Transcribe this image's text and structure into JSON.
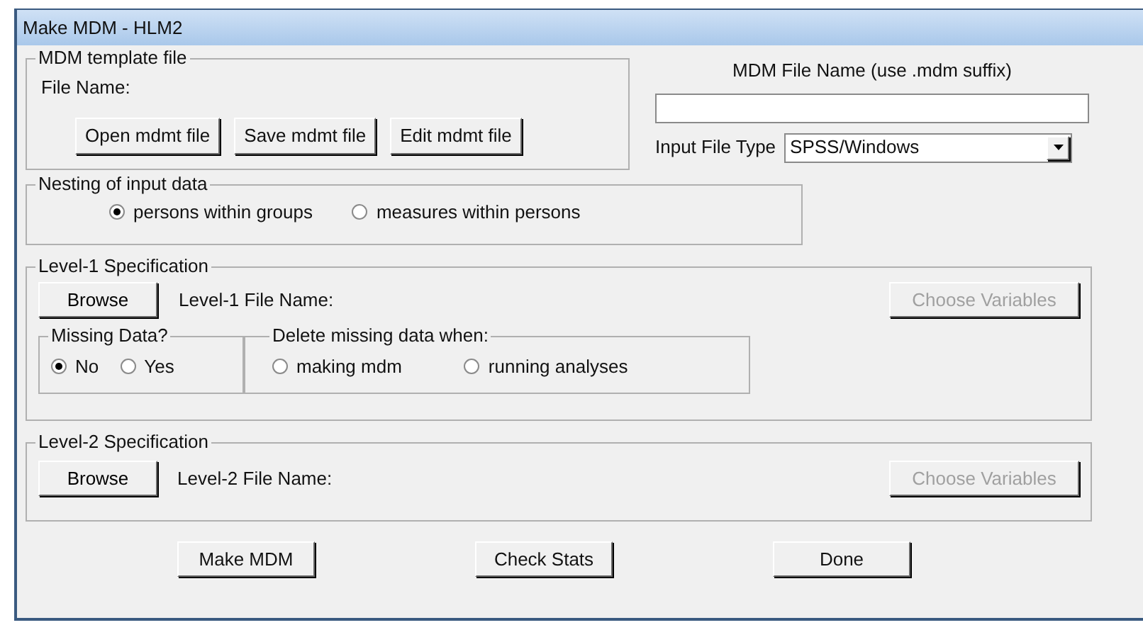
{
  "window": {
    "title": "Make MDM - HLM2"
  },
  "template": {
    "legend": "MDM template file",
    "file_label": "File Name:",
    "buttons": [
      "Open mdmt file",
      "Save mdmt file",
      "Edit mdmt file"
    ]
  },
  "mdm_file": {
    "label": "MDM File Name (use .mdm suffix)"
  },
  "input_file_type": {
    "label": "Input File Type",
    "value": "SPSS/Windows"
  },
  "nesting": {
    "legend": "Nesting of input data",
    "options": [
      {
        "label": "persons within groups",
        "selected": true
      },
      {
        "label": "measures within persons",
        "selected": false
      }
    ]
  },
  "level1": {
    "legend": "Level-1 Specification",
    "browse": "Browse",
    "file_label": "Level-1 File Name:",
    "choose": {
      "label": "Choose Variables",
      "disabled": true
    },
    "missing": {
      "legend": "Missing Data?",
      "options": [
        {
          "label": "No",
          "selected": true
        },
        {
          "label": "Yes",
          "selected": false
        }
      ]
    },
    "delete_when": {
      "legend": "Delete missing data when:",
      "options": [
        {
          "label": "making mdm",
          "selected": false
        },
        {
          "label": "running analyses",
          "selected": false
        }
      ]
    }
  },
  "level2": {
    "legend": "Level-2 Specification",
    "browse": "Browse",
    "file_label": "Level-2 File Name:",
    "choose": {
      "label": "Choose Variables",
      "disabled": true
    }
  },
  "buttons": [
    "Make MDM",
    "Check Stats",
    "Done"
  ]
}
